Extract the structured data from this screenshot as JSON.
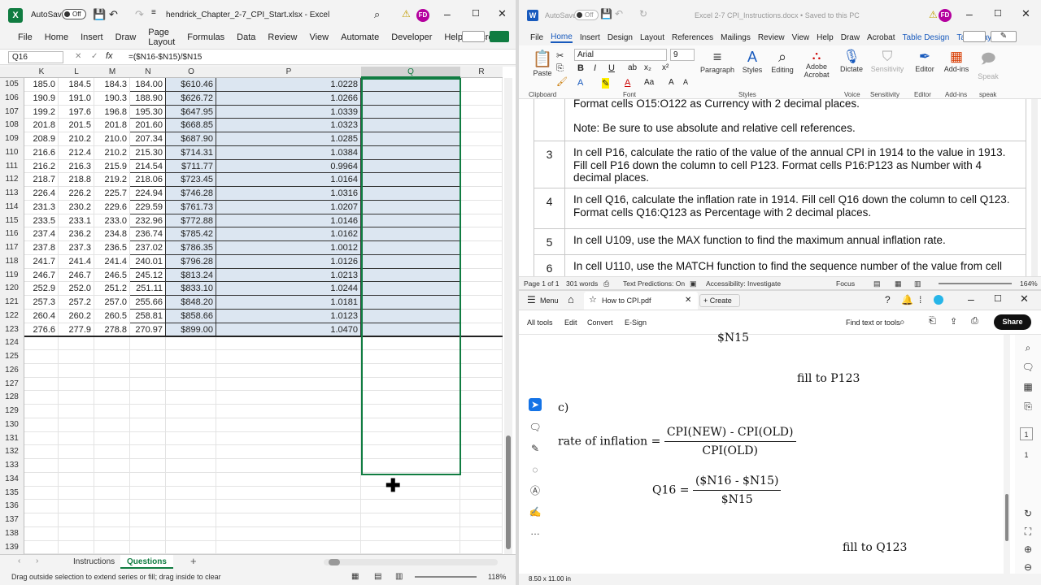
{
  "excel": {
    "autosave": "AutoSave",
    "autosave_state": "Off",
    "filename": "hendrick_Chapter_2-7_CPI_Start.xlsx - Excel",
    "user": "FD",
    "menu": [
      "File",
      "Home",
      "Insert",
      "Draw",
      "Page Layout",
      "Formulas",
      "Data",
      "Review",
      "View",
      "Automate",
      "Developer",
      "Help",
      "Acrobat"
    ],
    "namebox": "Q16",
    "formula": "=($N16-$N15)/$N15",
    "columns": [
      "K",
      "L",
      "M",
      "N",
      "O",
      "P",
      "Q",
      "R"
    ],
    "rows": [
      {
        "r": "105",
        "K": "185.0",
        "L": "184.5",
        "M": "184.3",
        "N": "184.00",
        "O": "$610.46",
        "P": "1.0228"
      },
      {
        "r": "106",
        "K": "190.9",
        "L": "191.0",
        "M": "190.3",
        "N": "188.90",
        "O": "$626.72",
        "P": "1.0266"
      },
      {
        "r": "107",
        "K": "199.2",
        "L": "197.6",
        "M": "196.8",
        "N": "195.30",
        "O": "$647.95",
        "P": "1.0339"
      },
      {
        "r": "108",
        "K": "201.8",
        "L": "201.5",
        "M": "201.8",
        "N": "201.60",
        "O": "$668.85",
        "P": "1.0323"
      },
      {
        "r": "109",
        "K": "208.9",
        "L": "210.2",
        "M": "210.0",
        "N": "207.34",
        "O": "$687.90",
        "P": "1.0285"
      },
      {
        "r": "110",
        "K": "216.6",
        "L": "212.4",
        "M": "210.2",
        "N": "215.30",
        "O": "$714.31",
        "P": "1.0384"
      },
      {
        "r": "111",
        "K": "216.2",
        "L": "216.3",
        "M": "215.9",
        "N": "214.54",
        "O": "$711.77",
        "P": "0.9964"
      },
      {
        "r": "112",
        "K": "218.7",
        "L": "218.8",
        "M": "219.2",
        "N": "218.06",
        "O": "$723.45",
        "P": "1.0164"
      },
      {
        "r": "113",
        "K": "226.4",
        "L": "226.2",
        "M": "225.7",
        "N": "224.94",
        "O": "$746.28",
        "P": "1.0316"
      },
      {
        "r": "114",
        "K": "231.3",
        "L": "230.2",
        "M": "229.6",
        "N": "229.59",
        "O": "$761.73",
        "P": "1.0207"
      },
      {
        "r": "115",
        "K": "233.5",
        "L": "233.1",
        "M": "233.0",
        "N": "232.96",
        "O": "$772.88",
        "P": "1.0146"
      },
      {
        "r": "116",
        "K": "237.4",
        "L": "236.2",
        "M": "234.8",
        "N": "236.74",
        "O": "$785.42",
        "P": "1.0162"
      },
      {
        "r": "117",
        "K": "237.8",
        "L": "237.3",
        "M": "236.5",
        "N": "237.02",
        "O": "$786.35",
        "P": "1.0012"
      },
      {
        "r": "118",
        "K": "241.7",
        "L": "241.4",
        "M": "241.4",
        "N": "240.01",
        "O": "$796.28",
        "P": "1.0126"
      },
      {
        "r": "119",
        "K": "246.7",
        "L": "246.7",
        "M": "246.5",
        "N": "245.12",
        "O": "$813.24",
        "P": "1.0213"
      },
      {
        "r": "120",
        "K": "252.9",
        "L": "252.0",
        "M": "251.2",
        "N": "251.11",
        "O": "$833.10",
        "P": "1.0244"
      },
      {
        "r": "121",
        "K": "257.3",
        "L": "257.2",
        "M": "257.0",
        "N": "255.66",
        "O": "$848.20",
        "P": "1.0181"
      },
      {
        "r": "122",
        "K": "260.4",
        "L": "260.2",
        "M": "260.5",
        "N": "258.81",
        "O": "$858.66",
        "P": "1.0123"
      },
      {
        "r": "123",
        "K": "276.6",
        "L": "277.9",
        "M": "278.8",
        "N": "270.97",
        "O": "$899.00",
        "P": "1.0470"
      },
      {
        "r": "124"
      },
      {
        "r": "125"
      },
      {
        "r": "126"
      },
      {
        "r": "127"
      },
      {
        "r": "128"
      },
      {
        "r": "129"
      },
      {
        "r": "130"
      },
      {
        "r": "131"
      },
      {
        "r": "132"
      },
      {
        "r": "133"
      },
      {
        "r": "134"
      },
      {
        "r": "135"
      },
      {
        "r": "136"
      },
      {
        "r": "137"
      },
      {
        "r": "138"
      },
      {
        "r": "139"
      }
    ],
    "sheets": [
      "Instructions",
      "Questions"
    ],
    "status": "Drag outside selection to extend series or fill; drag inside to clear",
    "zoom": "118%"
  },
  "word": {
    "autosave": "AutoSave",
    "autosave_state": "Off",
    "title": "Excel 2-7 CPI_Instructions.docx • Saved to this PC",
    "user": "FD",
    "menu": [
      "File",
      "Home",
      "Insert",
      "Design",
      "Layout",
      "References",
      "Mailings",
      "Review",
      "View",
      "Help",
      "Draw",
      "Acrobat",
      "Table Design",
      "Table Layout"
    ],
    "ribbon": {
      "paste": "Paste",
      "clipboard": "Clipboard",
      "font_name": "Arial",
      "font_size": "9",
      "font": "Font",
      "paragraph": "Paragraph",
      "styles": "Styles",
      "editing": "Editing",
      "adobe": "Adobe Acrobat",
      "dictate": "Dictate",
      "voice": "Voice",
      "sensitivity": "Sensitivity",
      "editor": "Editor",
      "addins": "Add-ins",
      "speak": "Speak",
      "speak_grp": "speak"
    },
    "rows": [
      {
        "num": "",
        "text": "Format cells O15:O122 as Currency with 2 decimal places.",
        "note": "Note: Be sure to use absolute and relative cell references."
      },
      {
        "num": "3",
        "text": "In cell P16, calculate the ratio of the value of the annual CPI in 1914 to the value in 1913. Fill cell P16 down the column to cell P123. Format cells P16:P123 as Number with 4 decimal places."
      },
      {
        "num": "4",
        "text": "In cell Q16, calculate the inflation rate in 1914. Fill cell Q16 down the column to cell Q123. Format cells Q16:Q123 as Percentage with 2 decimal places."
      },
      {
        "num": "5",
        "text": "In cell U109, use the MAX function to find the maximum annual inflation rate."
      },
      {
        "num": "6",
        "text": "In cell U110, use the MATCH function to find the sequence number of the value from cell"
      }
    ],
    "status": {
      "page": "Page 1 of 1",
      "words": "301 words",
      "predictions": "Text Predictions: On",
      "accessibility": "Accessibility: Investigate",
      "focus": "Focus",
      "zoom": "164%"
    }
  },
  "pdf": {
    "menu": "Menu",
    "tab": "How to CPI.pdf",
    "create": "Create",
    "tools": [
      "All tools",
      "Edit",
      "Convert",
      "E-Sign"
    ],
    "find": "Find text or tools",
    "share": "Share",
    "line_top": "$N15",
    "fill1": "fill to P123",
    "part": "c)",
    "rate_label": "rate of inflation =",
    "rate_num": "CPI(NEW) - CPI(OLD)",
    "rate_den": "CPI(OLD)",
    "q_label": "Q16 =",
    "q_num": "($N16 - $N15)",
    "q_den": "$N15",
    "fill2": "fill to Q123",
    "page_num": "1",
    "page_total": "1",
    "size": "8.50 x 11.00 in"
  }
}
